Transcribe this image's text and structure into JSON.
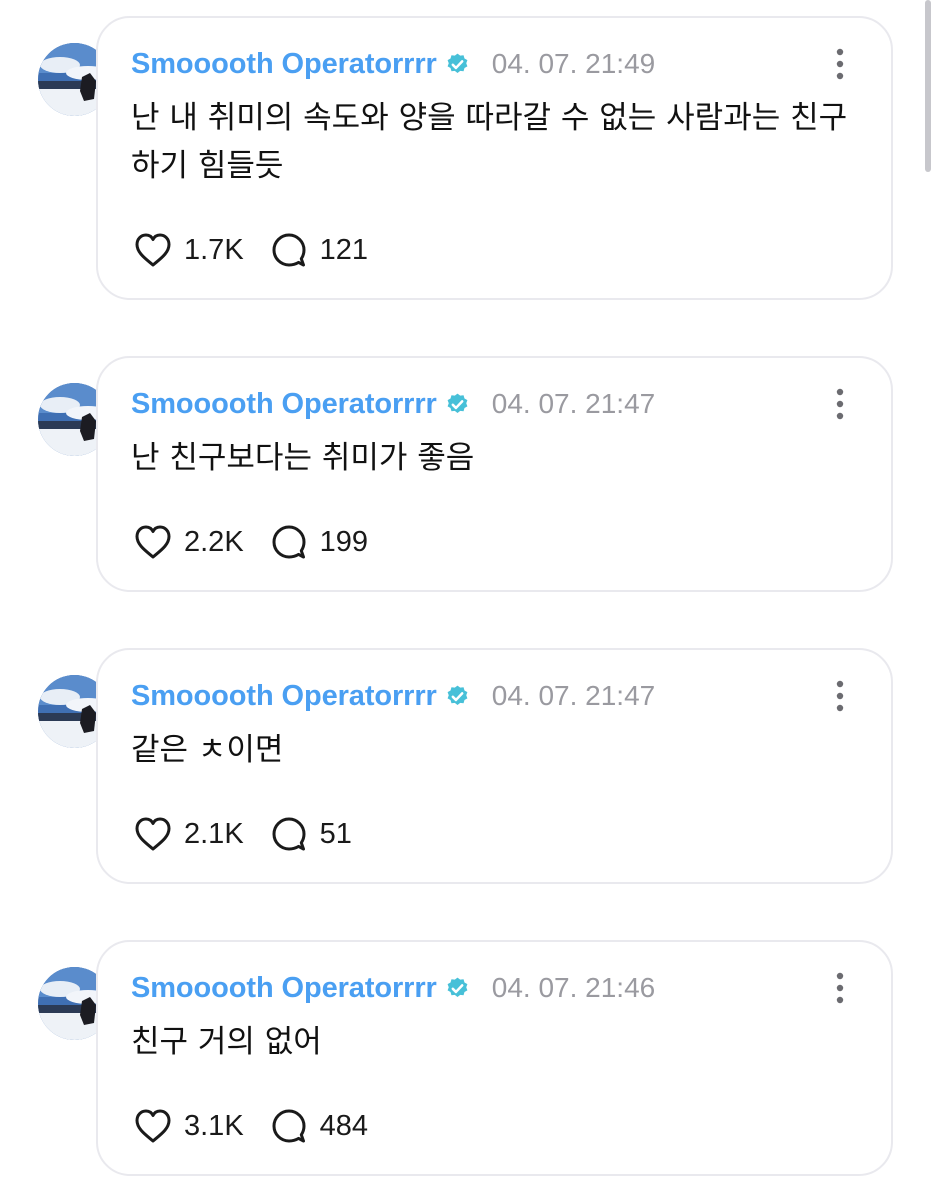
{
  "accent": "#4a9ff2",
  "verified_color": "#47c0d8",
  "posts": [
    {
      "username": "Smooooth Operatorrrr",
      "verified": "verified-badge-icon",
      "timestamp": "04. 07. 21:49",
      "text": "난 내 취미의 속도와 양을 따라갈 수 없는 사람과는 친구하기 힘들듯",
      "likes": "1.7K",
      "replies": "121"
    },
    {
      "username": "Smooooth Operatorrrr",
      "verified": "verified-badge-icon",
      "timestamp": "04. 07. 21:47",
      "text": "난 친구보다는 취미가 좋음",
      "likes": "2.2K",
      "replies": "199"
    },
    {
      "username": "Smooooth Operatorrrr",
      "verified": "verified-badge-icon",
      "timestamp": "04. 07. 21:47",
      "text": "같은 ㅊ이면",
      "likes": "2.1K",
      "replies": "51"
    },
    {
      "username": "Smooooth Operatorrrr",
      "verified": "verified-badge-icon",
      "timestamp": "04. 07. 21:46",
      "text": "친구 거의 없어",
      "likes": "3.1K",
      "replies": "484"
    }
  ]
}
